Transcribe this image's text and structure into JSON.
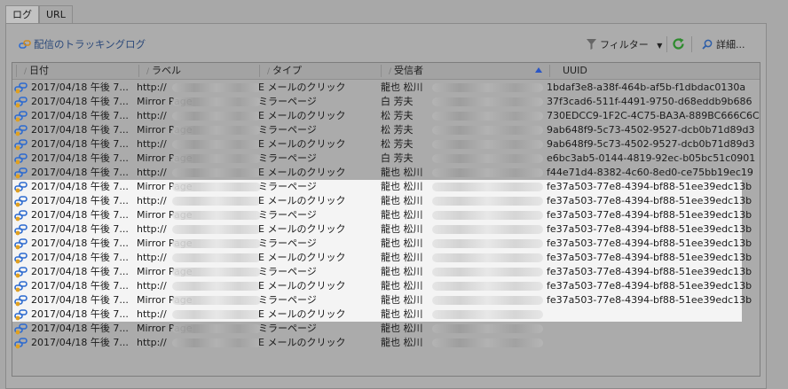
{
  "tabs": [
    {
      "label": "ログ"
    },
    {
      "label": "URL"
    }
  ],
  "toolbar": {
    "title": "配信のトラッキングログ",
    "filter_label": "フィルター",
    "detail_label": "詳細..."
  },
  "columns": [
    "日付",
    "ラベル",
    "タイプ",
    "受信者",
    "UUID"
  ],
  "colors": {
    "toolbar_title": "#2d4a7a",
    "sort_arrow": "#2a56c6",
    "refresh": "#2e8b2e",
    "highlight": "#f4f4f4"
  },
  "rows": [
    {
      "date": "2017/04/18 午後 7...",
      "label": "http://",
      "type": "E メールのクリック",
      "recipient": "龍也 松川",
      "uuid": "1bdaf3e8-a38f-464b-af5b-f1dbdac0130a",
      "highlight": false
    },
    {
      "date": "2017/04/18 午後 7...",
      "label": "Mirror Page",
      "type": "ミラーページ",
      "recipient": "白 芳夫",
      "uuid": "37f3cad6-511f-4491-9750-d68eddb9b686",
      "highlight": false
    },
    {
      "date": "2017/04/18 午後 7...",
      "label": "http://",
      "type": "E メールのクリック",
      "recipient": "松 芳夫",
      "uuid": "730EDCC9-1F2C-4C75-BA3A-889BC666C6C7",
      "highlight": false
    },
    {
      "date": "2017/04/18 午後 7...",
      "label": "Mirror Page",
      "type": "ミラーページ",
      "recipient": "松 芳夫",
      "uuid": "9ab648f9-5c73-4502-9527-dcb0b71d89d3",
      "highlight": false
    },
    {
      "date": "2017/04/18 午後 7...",
      "label": "http://",
      "type": "E メールのクリック",
      "recipient": "松 芳夫",
      "uuid": "9ab648f9-5c73-4502-9527-dcb0b71d89d3",
      "highlight": false
    },
    {
      "date": "2017/04/18 午後 7...",
      "label": "Mirror Page",
      "type": "ミラーページ",
      "recipient": "白 芳夫",
      "uuid": "e6bc3ab5-0144-4819-92ec-b05bc51c0901",
      "highlight": false
    },
    {
      "date": "2017/04/18 午後 7...",
      "label": "http://",
      "type": "E メールのクリック",
      "recipient": "龍也 松川",
      "uuid": "f44e71d4-8382-4c60-8ed0-ce75bb19ec19",
      "highlight": false
    },
    {
      "date": "2017/04/18 午後 7...",
      "label": "Mirror Page",
      "type": "ミラーページ",
      "recipient": "龍也 松川",
      "uuid": "fe37a503-77e8-4394-bf88-51ee39edc13b",
      "highlight": true
    },
    {
      "date": "2017/04/18 午後 7...",
      "label": "http://",
      "type": "E メールのクリック",
      "recipient": "龍也 松川",
      "uuid": "fe37a503-77e8-4394-bf88-51ee39edc13b",
      "highlight": true
    },
    {
      "date": "2017/04/18 午後 7...",
      "label": "Mirror Page",
      "type": "ミラーページ",
      "recipient": "龍也 松川",
      "uuid": "fe37a503-77e8-4394-bf88-51ee39edc13b",
      "highlight": true
    },
    {
      "date": "2017/04/18 午後 7...",
      "label": "http://",
      "type": "E メールのクリック",
      "recipient": "龍也 松川",
      "uuid": "fe37a503-77e8-4394-bf88-51ee39edc13b",
      "highlight": true
    },
    {
      "date": "2017/04/18 午後 7...",
      "label": "Mirror Page",
      "type": "ミラーページ",
      "recipient": "龍也 松川",
      "uuid": "fe37a503-77e8-4394-bf88-51ee39edc13b",
      "highlight": true
    },
    {
      "date": "2017/04/18 午後 7...",
      "label": "http://",
      "type": "E メールのクリック",
      "recipient": "龍也 松川",
      "uuid": "fe37a503-77e8-4394-bf88-51ee39edc13b",
      "highlight": true
    },
    {
      "date": "2017/04/18 午後 7...",
      "label": "Mirror Page",
      "type": "ミラーページ",
      "recipient": "龍也 松川",
      "uuid": "fe37a503-77e8-4394-bf88-51ee39edc13b",
      "highlight": true
    },
    {
      "date": "2017/04/18 午後 7...",
      "label": "http://",
      "type": "E メールのクリック",
      "recipient": "龍也 松川",
      "uuid": "fe37a503-77e8-4394-bf88-51ee39edc13b",
      "highlight": true
    },
    {
      "date": "2017/04/18 午後 7...",
      "label": "Mirror Page",
      "type": "ミラーページ",
      "recipient": "龍也 松川",
      "uuid": "fe37a503-77e8-4394-bf88-51ee39edc13b",
      "highlight": true
    },
    {
      "date": "2017/04/18 午後 7...",
      "label": "http://",
      "type": "E メールのクリック",
      "recipient": "龍也 松川",
      "uuid": "",
      "highlight": true
    },
    {
      "date": "2017/04/18 午後 7...",
      "label": "Mirror Page",
      "type": "ミラーページ",
      "recipient": "龍也 松川",
      "uuid": "",
      "highlight": false
    },
    {
      "date": "2017/04/18 午後 7...",
      "label": "http://",
      "type": "E メールのクリック",
      "recipient": "龍也 松川",
      "uuid": "",
      "highlight": false
    }
  ]
}
